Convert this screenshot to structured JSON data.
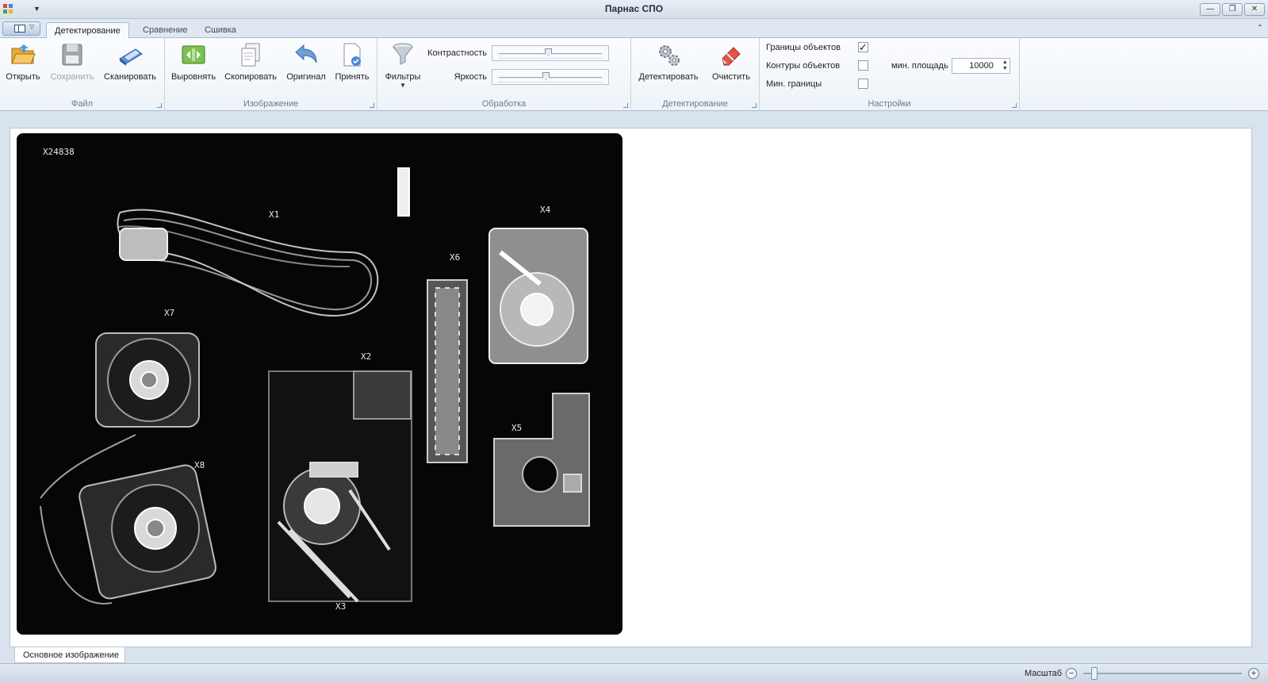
{
  "window": {
    "title": "Парнас СПО",
    "buttons": {
      "minimize": "—",
      "restore": "❐",
      "close": "✕"
    }
  },
  "ribbon": {
    "tabs": [
      {
        "label": "Детектирование",
        "active": true
      },
      {
        "label": "Сравнение",
        "active": false
      },
      {
        "label": "Сшивка",
        "active": false
      }
    ],
    "groups": {
      "file": {
        "label": "Файл",
        "open": "Открыть",
        "save": "Сохранить",
        "scan": "Сканировать"
      },
      "image": {
        "label": "Изображение",
        "align": "Выровнять",
        "copy": "Скопировать",
        "original": "Оригинал",
        "accept": "Принять"
      },
      "processing": {
        "label": "Обработка",
        "filters": "Фильтры",
        "contrast_label": "Контрастность",
        "contrast_level": 0.5,
        "brightness_label": "Яркость",
        "brightness_level": 0.48
      },
      "detection": {
        "label": "Детектирование",
        "detect": "Детектировать",
        "clear": "Очистить"
      },
      "settings": {
        "label": "Настройки",
        "object_bounds_label": "Границы объектов",
        "object_bounds_checked": true,
        "object_contours_label": "Контуры объектов",
        "object_contours_checked": false,
        "min_bounds_label": "Мин. границы",
        "min_bounds_checked": false,
        "min_area_label": "мин. площадь",
        "min_area_value": "10000"
      }
    }
  },
  "image": {
    "labels": {
      "serial": "X24838",
      "x1": "X1",
      "x2": "X2",
      "x3": "X3",
      "x4": "X4",
      "x5": "X5",
      "x6": "X6",
      "x7": "X7",
      "x8": "X8"
    }
  },
  "document_tab": "Основное изображение",
  "statusbar": {
    "zoom_label": "Масштаб",
    "zoom_level": 0.05
  }
}
